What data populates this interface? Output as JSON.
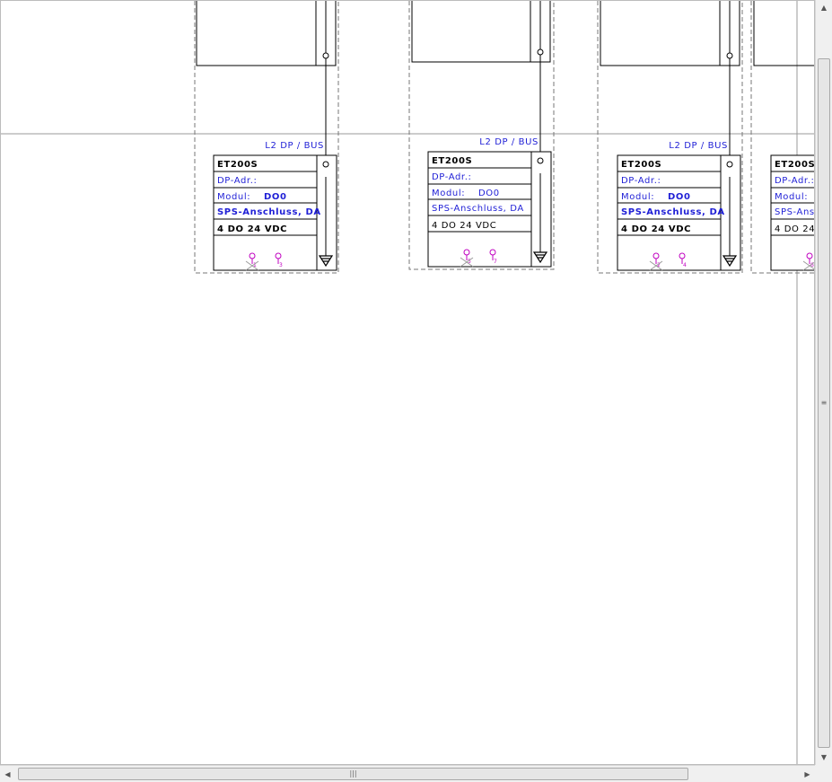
{
  "bus_label": "L2 DP / BUS",
  "modules": [
    {
      "type": "ET200S",
      "dp_addr_label": "DP-Adr.:",
      "module_label": "Modul:",
      "module_value": "DO0",
      "sps_label": "SPS-Anschluss, DA",
      "spec": "4 DO  24 VDC",
      "terminals": [
        "1",
        "3"
      ],
      "bold": true
    },
    {
      "type": "ET200S",
      "dp_addr_label": "DP-Adr.:",
      "module_label": "Modul:",
      "module_value": "DO0",
      "sps_label": "SPS-Anschluss, DA",
      "spec": "4 DO  24 VDC",
      "terminals": [
        "5",
        "7"
      ],
      "bold": false
    },
    {
      "type": "ET200S",
      "dp_addr_label": "DP-Adr.:",
      "module_label": "Modul:",
      "module_value": "DO0",
      "sps_label": "SPS-Anschluss, DA",
      "spec": "4 DO  24 VDC",
      "terminals": [
        "2",
        "4"
      ],
      "bold": true
    },
    {
      "type": "ET200S",
      "dp_addr_label": "DP-Adr.:",
      "module_label": "Modul:",
      "module_value": "DO",
      "sps_label": "SPS-Ans",
      "spec": "4 DO  24",
      "terminals": [
        "6"
      ],
      "bold": false
    }
  ],
  "scrollbars": {
    "vertical_grip": "≡",
    "horizontal_grip": "|||",
    "up_icon": "▲",
    "down_icon": "▼",
    "left_icon": "◀",
    "right_icon": "▶"
  }
}
